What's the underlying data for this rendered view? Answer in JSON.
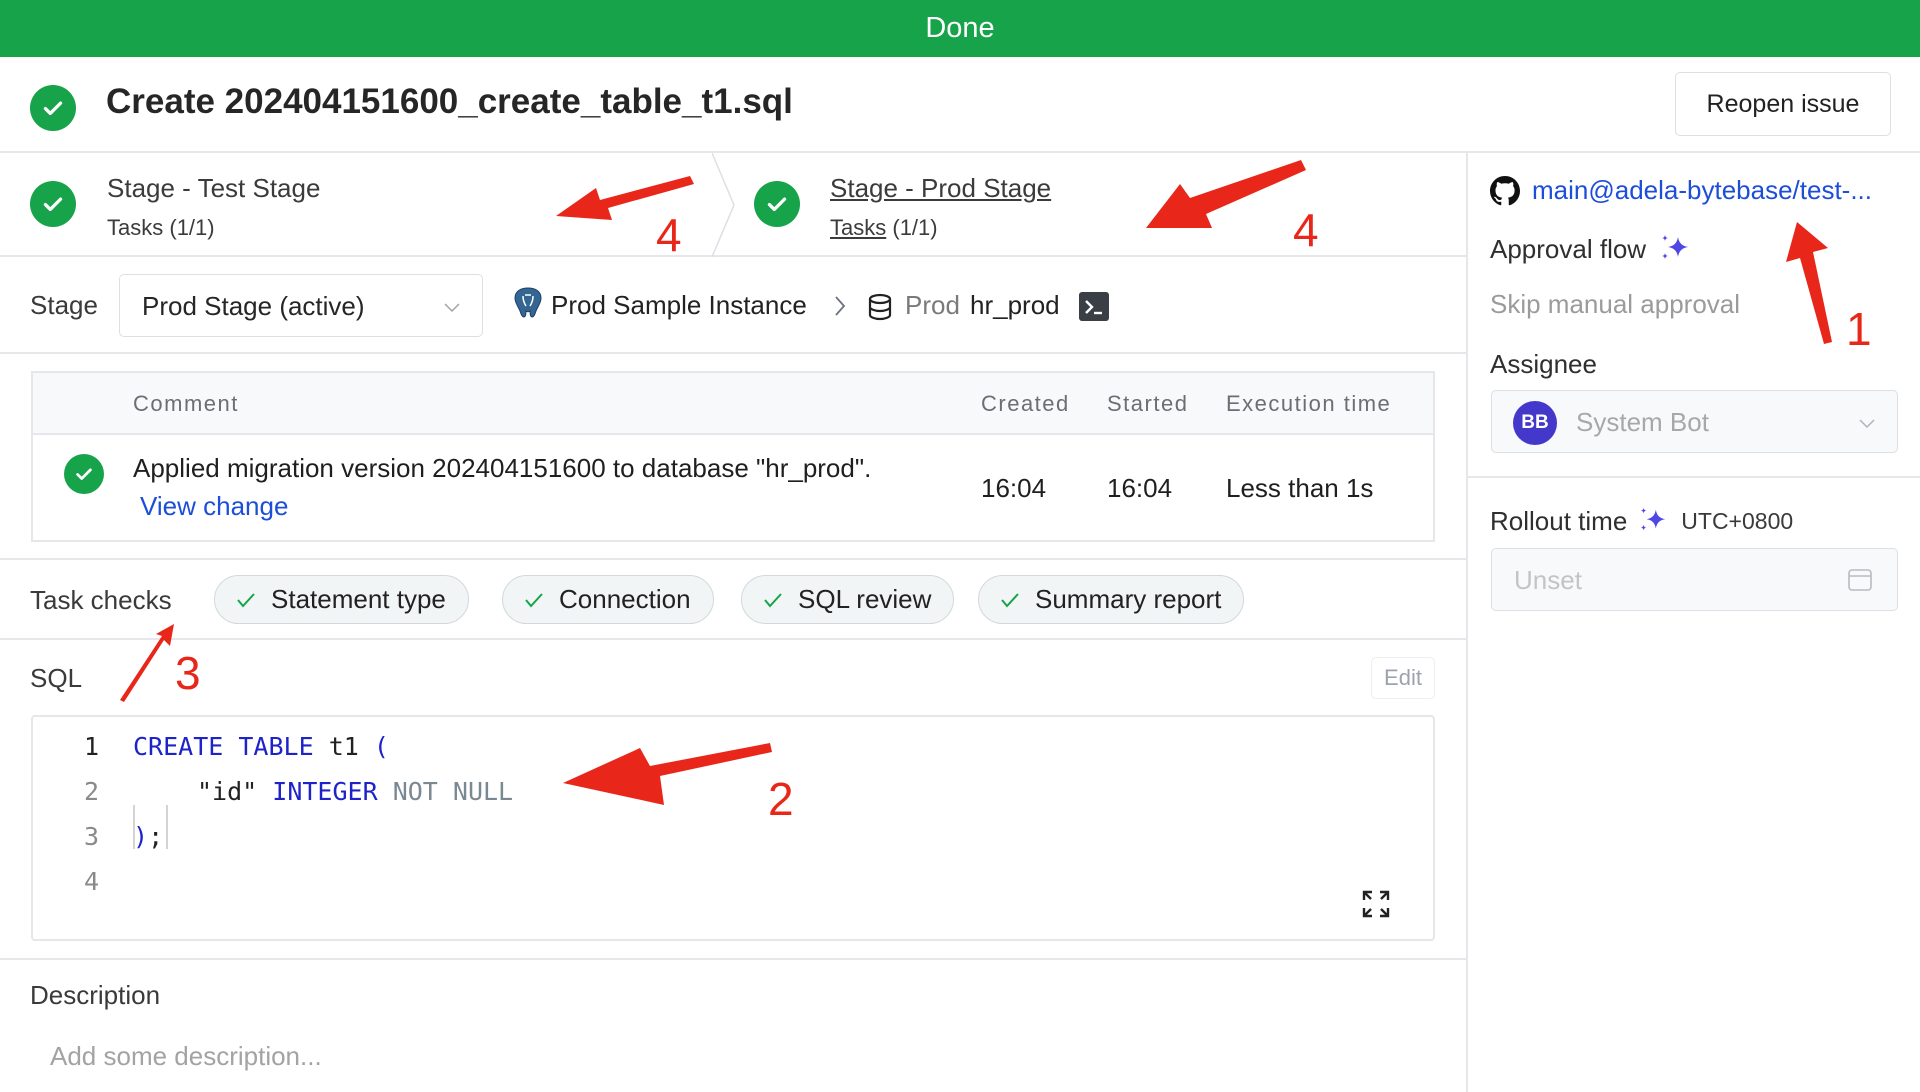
{
  "banner": {
    "status": "Done",
    "color": "#17a34a"
  },
  "header": {
    "title": "Create 202404151600_create_table_t1.sql",
    "status_icon": "check-circle-icon",
    "reopen_label": "Reopen issue"
  },
  "stages": [
    {
      "name": "Stage - Test Stage",
      "tasks_label": "Tasks",
      "tasks_count": "(1/1)",
      "status": "done",
      "active": false
    },
    {
      "name": "Stage - Prod Stage",
      "tasks_label": "Tasks",
      "tasks_count": "(1/1)",
      "status": "done",
      "active": true
    }
  ],
  "stage_selector": {
    "label": "Stage",
    "selected": "Prod Stage (active)",
    "instance_icon": "postgresql-icon",
    "instance": "Prod Sample Instance",
    "separator": ">",
    "database_env": "Prod",
    "database": "hr_prod",
    "database_icon": "database-icon",
    "terminal_icon": "terminal-icon"
  },
  "task_table": {
    "columns": [
      "Comment",
      "Created",
      "Started",
      "Execution time"
    ],
    "rows": [
      {
        "status": "done",
        "comment": "Applied migration version 202404151600 to database \"hr_prod\".",
        "link": "View change",
        "created": "16:04",
        "started": "16:04",
        "execution_time": "Less than 1s"
      }
    ]
  },
  "task_checks": {
    "label": "Task checks",
    "items": [
      {
        "label": "Statement type",
        "status": "success"
      },
      {
        "label": "Connection",
        "status": "success"
      },
      {
        "label": "SQL review",
        "status": "success"
      },
      {
        "label": "Summary report",
        "status": "success"
      }
    ]
  },
  "sql": {
    "label": "SQL",
    "edit_label": "Edit",
    "lines": [
      {
        "n": "1",
        "tokens": [
          {
            "t": "CREATE",
            "c": "kw"
          },
          {
            "t": " ",
            "c": "txt"
          },
          {
            "t": "TABLE",
            "c": "kw"
          },
          {
            "t": " t1 ",
            "c": "txt"
          },
          {
            "t": "(",
            "c": "kw"
          }
        ]
      },
      {
        "n": "2",
        "tokens": [
          {
            "t": "\"id\"",
            "c": "str"
          },
          {
            "t": " ",
            "c": "txt"
          },
          {
            "t": "INTEGER",
            "c": "kw"
          },
          {
            "t": " ",
            "c": "txt"
          },
          {
            "t": "NOT NULL",
            "c": "kw2"
          }
        ]
      },
      {
        "n": "3",
        "tokens": [
          {
            "t": ")",
            "c": "kw"
          },
          {
            "t": ";",
            "c": "txt"
          }
        ]
      },
      {
        "n": "4",
        "tokens": []
      }
    ]
  },
  "description": {
    "label": "Description",
    "placeholder": "Add some description..."
  },
  "sidebar": {
    "vcs_icon": "github-icon",
    "vcs_link": "main@adela-bytebase/test-...",
    "approval_flow_label": "Approval flow",
    "approval_flow_value": "Skip manual approval",
    "assignee_label": "Assignee",
    "assignee_initials": "BB",
    "assignee_name": "System Bot",
    "rollout_label": "Rollout time",
    "timezone": "UTC+0800",
    "rollout_placeholder": "Unset",
    "accent_color": "#4f46e5"
  },
  "annotations": [
    "1",
    "2",
    "3",
    "4",
    "4"
  ]
}
